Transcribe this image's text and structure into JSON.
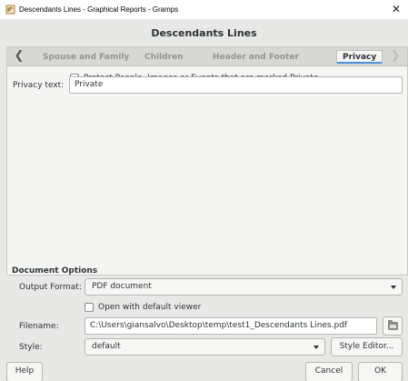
{
  "window": {
    "title": "Descendants Lines - Graphical Reports - Gramps",
    "close_glyph": "✕"
  },
  "dialog": {
    "header": "Descendants Lines"
  },
  "tabs": {
    "prev_glyph": "❮",
    "next_glyph": "❯",
    "items": [
      {
        "label": "Spouse and Family",
        "active": false
      },
      {
        "label": "Children",
        "active": false
      },
      {
        "label": "Header and Footer",
        "active": false
      },
      {
        "label": "Privacy",
        "active": true
      }
    ]
  },
  "privacy": {
    "protect_label": "Protect People, Images or Events that are marked Private",
    "protect_checked": true,
    "privacy_text_label": "Privacy text:",
    "privacy_text_value": "Private"
  },
  "document_options": {
    "title": "Document Options",
    "output_format_label": "Output Format:",
    "output_format_value": "PDF document",
    "open_viewer_label": "Open with default viewer",
    "open_viewer_checked": false,
    "filename_label": "Filename:",
    "filename_value": "C:\\Users\\giansalvo\\Desktop\\temp\\test1_Descendants Lines.pdf",
    "style_label": "Style:",
    "style_value": "default",
    "style_editor_label": "Style Editor..."
  },
  "footer": {
    "help_label": "Help",
    "cancel_label": "Cancel",
    "ok_label": "OK"
  },
  "icons": {
    "app": "gramps-tree-icon",
    "folder": "folder-icon"
  },
  "colors": {
    "dialog_bg": "#e8e8e7",
    "active_tab_underline": "#4a90d9"
  }
}
